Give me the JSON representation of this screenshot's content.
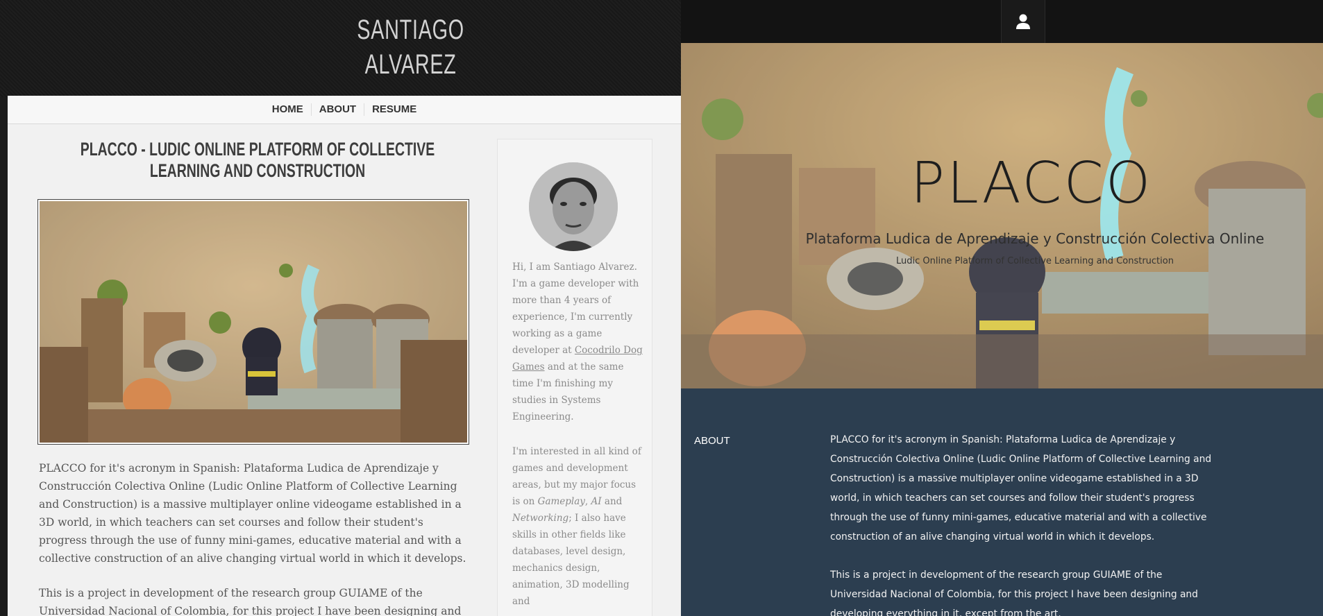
{
  "left_site": {
    "site_title": "SANTIAGO ALVAREZ",
    "nav": [
      "HOME",
      "ABOUT",
      "RESUME"
    ],
    "post": {
      "title": "PLACCO - LUDIC ONLINE PLATFORM OF COLLECTIVE LEARNING AND CONSTRUCTION",
      "paragraphs": [
        "PLACCO for it's acronym in Spanish: Plataforma Ludica de Aprendizaje y Construcción Colectiva Online (Ludic Online Platform of Collective Learning and Construction) is a massive multiplayer online videogame established in a 3D world, in which teachers can set courses and follow their student's progress through the use of funny mini-games, educative material and with a collective construction of an alive changing virtual world in which it develops.",
        "This is a project in development of the research group GUIAME of the Universidad Nacional of Colombia, for this project I have been designing and developing"
      ]
    },
    "sidebar": {
      "bio_start": "Hi, I am Santiago Alvarez. I'm a game developer with more than 4 years of experience, I'm currently working as a game developer at ",
      "company_link": "Cocodrilo Dog Games",
      "bio_end": " and at the same time I'm finishing my studies in Systems Engineering.",
      "interests_start": "I'm interested in all kind of games and development areas, but my major focus is on ",
      "focus1": "Gameplay",
      "focus_sep": ", ",
      "focus2": "AI",
      "focus_and": " and ",
      "focus3": "Networking",
      "interests_end": "; I also have skills in other fields like databases, level design, mechanics design, animation, 3D modelling and"
    }
  },
  "right_site": {
    "hero_title": "PLACCO",
    "hero_subtitle": "Plataforma Ludica de Aprendizaje y Construcción Colectiva Online",
    "hero_subtitle_en": "Ludic Online Platform of Collective Learning and Construction",
    "about_label": "ABOUT",
    "about_paragraphs": [
      "PLACCO for it's acronym in Spanish: Plataforma Ludica de Aprendizaje y Construcción Colectiva Online (Ludic Online Platform of Collective Learning and Construction) is a massive multiplayer online videogame established in a 3D world, in which teachers can set courses and follow their student's progress through the use of funny mini-games, educative material and with a collective construction of an alive changing virtual world in which it develops.",
      "This is a project in development of the research group GUIAME of the Universidad Nacional of Colombia, for this project I have been designing and developing everything in it, except from the art."
    ],
    "user_icon": "user-icon"
  },
  "colors": {
    "right_content_bg": "#2c3e50",
    "topbar_bg": "#131313",
    "left_panel_bg": "#f1f1f1"
  }
}
